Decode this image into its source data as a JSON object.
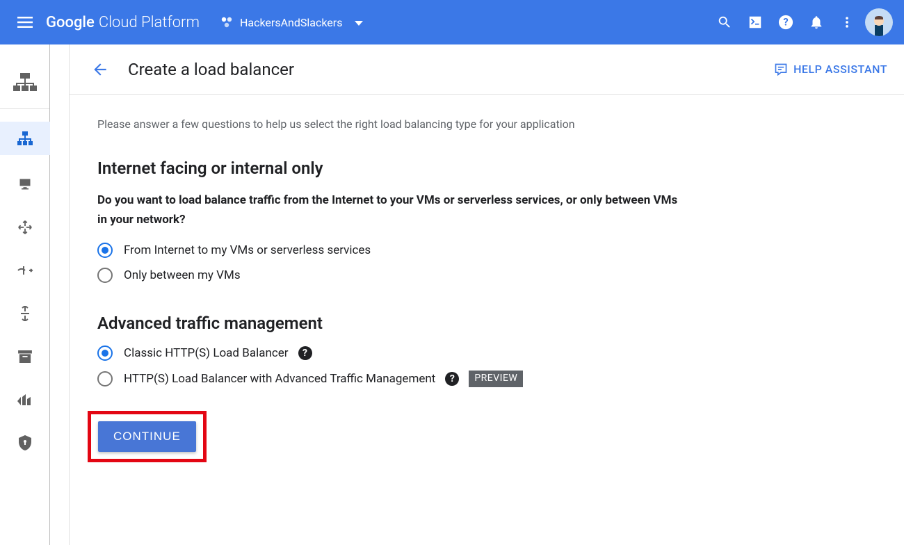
{
  "header": {
    "product_name_1": "Google",
    "product_name_2": "Cloud Platform",
    "project_name": "HackersAndSlackers"
  },
  "page": {
    "title": "Create a load balancer",
    "help_assistant": "HELP ASSISTANT",
    "intro": "Please answer a few questions to help us select the right load balancing type for your application"
  },
  "section1": {
    "heading": "Internet facing or internal only",
    "subheading": "Do you want to load balance traffic from the Internet to your VMs or serverless services, or only between VMs in your network?",
    "option1": "From Internet to my VMs or serverless services",
    "option2": "Only between my VMs"
  },
  "section2": {
    "heading": "Advanced traffic management",
    "option1": "Classic HTTP(S) Load Balancer",
    "option2": "HTTP(S) Load Balancer with Advanced Traffic Management",
    "preview_badge": "PREVIEW"
  },
  "buttons": {
    "continue": "CONTINUE"
  }
}
